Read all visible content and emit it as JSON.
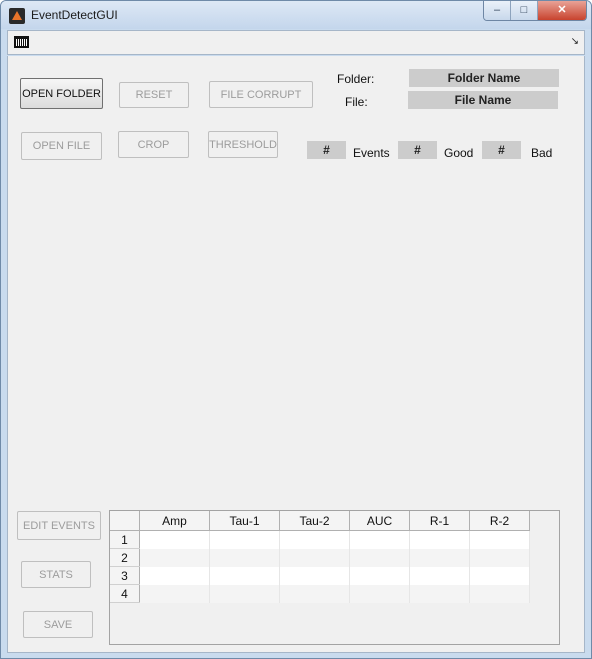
{
  "window": {
    "title": "EventDetectGUI",
    "controls": {
      "minimize": "–",
      "maximize": "□",
      "close": "✕"
    }
  },
  "toolbar": {
    "app_icon": "histogram-icon",
    "overflow_icon": "↘"
  },
  "buttons": {
    "open_folder": "OPEN FOLDER",
    "reset": "RESET",
    "file_corrupt": "FILE CORRUPT",
    "open_file": "OPEN FILE",
    "crop": "CROP",
    "threshold": "THRESHOLD",
    "edit_events": "EDIT EVENTS",
    "stats": "STATS",
    "save": "SAVE"
  },
  "info": {
    "folder_label": "Folder:",
    "folder_value": "Folder Name",
    "file_label": "File:",
    "file_value": "File Name"
  },
  "counts": {
    "events_value": "#",
    "events_label": "Events",
    "good_value": "#",
    "good_label": "Good",
    "bad_value": "#",
    "bad_label": "Bad"
  },
  "table": {
    "columns": [
      "Amp",
      "Tau-1",
      "Tau-2",
      "AUC",
      "R-1",
      "R-2"
    ],
    "rows": [
      "1",
      "2",
      "3",
      "4"
    ]
  }
}
